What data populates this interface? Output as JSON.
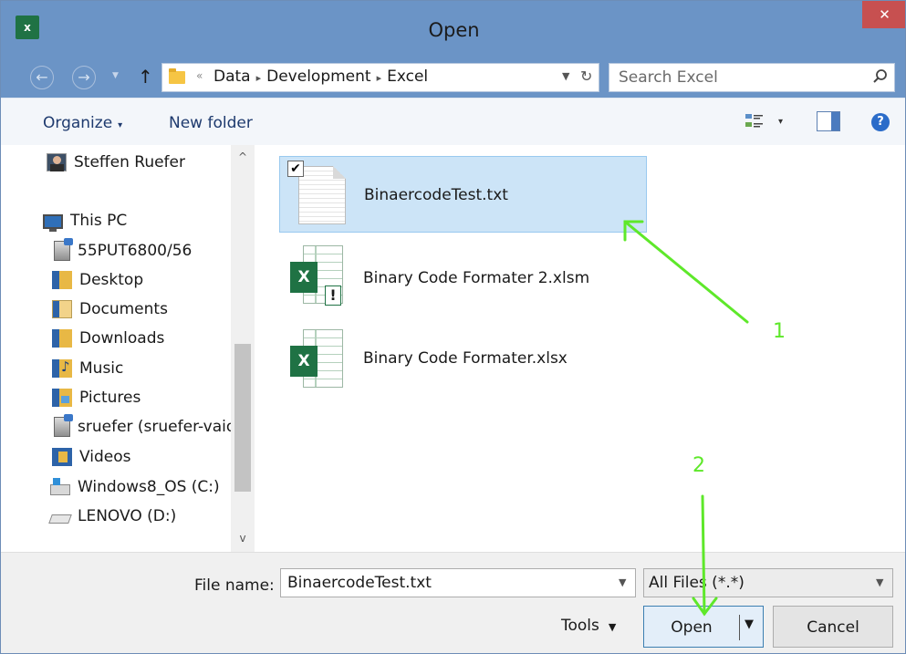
{
  "window": {
    "title": "Open",
    "app_icon_text": "x",
    "close_glyph": "✕"
  },
  "address_bar": {
    "breadcrumb_prefix": "«",
    "breadcrumbs": [
      "Data",
      "Development",
      "Excel"
    ],
    "separator": "▸"
  },
  "search": {
    "placeholder": "Search Excel"
  },
  "toolbar": {
    "organize_label": "Organize",
    "new_folder_label": "New folder",
    "help_glyph": "?"
  },
  "nav": {
    "items": [
      {
        "label": "Steffen Ruefer",
        "icon": "user-avatar-icon"
      },
      {
        "label": "This PC",
        "icon": "computer-icon"
      },
      {
        "label": "55PUT6800/56",
        "icon": "network-drive-icon"
      },
      {
        "label": "Desktop",
        "icon": "desktop-folder-icon"
      },
      {
        "label": "Documents",
        "icon": "documents-folder-icon"
      },
      {
        "label": "Downloads",
        "icon": "downloads-folder-icon"
      },
      {
        "label": "Music",
        "icon": "music-folder-icon"
      },
      {
        "label": "Pictures",
        "icon": "pictures-folder-icon"
      },
      {
        "label": "sruefer (sruefer-vaio",
        "icon": "network-drive-icon"
      },
      {
        "label": "Videos",
        "icon": "videos-folder-icon"
      },
      {
        "label": "Windows8_OS (C:)",
        "icon": "windows-drive-icon"
      },
      {
        "label": "LENOVO (D:)",
        "icon": "drive-icon"
      }
    ]
  },
  "files": {
    "items": [
      {
        "name": "BinaercodeTest.txt",
        "icon": "text-file-icon",
        "selected": true
      },
      {
        "name": "Binary Code Formater 2.xlsm",
        "icon": "excel-macro-file-icon",
        "selected": false
      },
      {
        "name": "Binary Code Formater.xlsx",
        "icon": "excel-file-icon",
        "selected": false
      }
    ]
  },
  "annotations": {
    "label_1": "1",
    "label_2": "2",
    "color": "#5ee82a"
  },
  "bottom": {
    "file_name_label": "File name:",
    "file_name_value": "BinaercodeTest.txt",
    "file_type_value": "All Files (*.*)",
    "tools_label": "Tools",
    "open_label": "Open",
    "cancel_label": "Cancel"
  },
  "colors": {
    "title_bar": "#6b94c6",
    "selection": "#cce4f7",
    "close_button": "#c75050",
    "excel_green": "#1f7244"
  }
}
